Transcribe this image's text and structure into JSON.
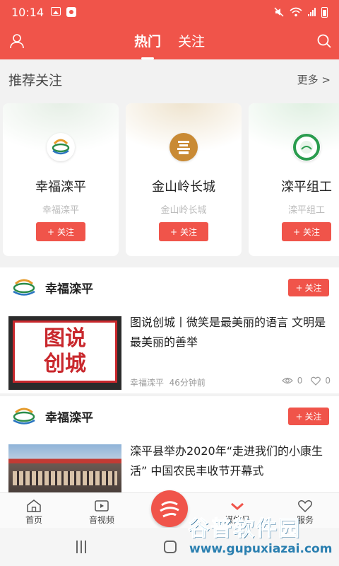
{
  "status_bar": {
    "time": "10:14"
  },
  "header": {
    "tabs": [
      {
        "label": "热门",
        "active": true
      },
      {
        "label": "关注",
        "active": false
      }
    ]
  },
  "recommend": {
    "title": "推荐关注",
    "more": "更多 >",
    "cards": [
      {
        "name": "幸福滦平",
        "sub": "幸福滦平",
        "follow": "关注"
      },
      {
        "name": "金山岭长城",
        "sub": "金山岭长城",
        "follow": "关注"
      },
      {
        "name": "滦平组工",
        "sub": "滦平组工",
        "follow": "关注"
      }
    ]
  },
  "feed": [
    {
      "source": "幸福滦平",
      "follow": "关注",
      "title": "图说创城丨微笑是最美丽的语言 文明是最美丽的善举",
      "thumb_text": [
        "图说",
        "创城"
      ],
      "meta_source": "幸福滦平",
      "meta_time": "46分钟前",
      "views": "0",
      "likes": "0"
    },
    {
      "source": "幸福滦平",
      "follow": "关注",
      "title": "滦平县举办2020年“走进我们的小康生活” 中国农民丰收节开幕式"
    }
  ],
  "bottom_nav": [
    {
      "label": "首页"
    },
    {
      "label": "音视频"
    },
    {
      "label": "媒体号"
    },
    {
      "label": "服务"
    }
  ],
  "watermark": {
    "title": "谷普软件园",
    "url": "www.gupuxiazai.com"
  },
  "colors": {
    "brand_red": "#f0544a",
    "background": "#f2f2f2"
  }
}
